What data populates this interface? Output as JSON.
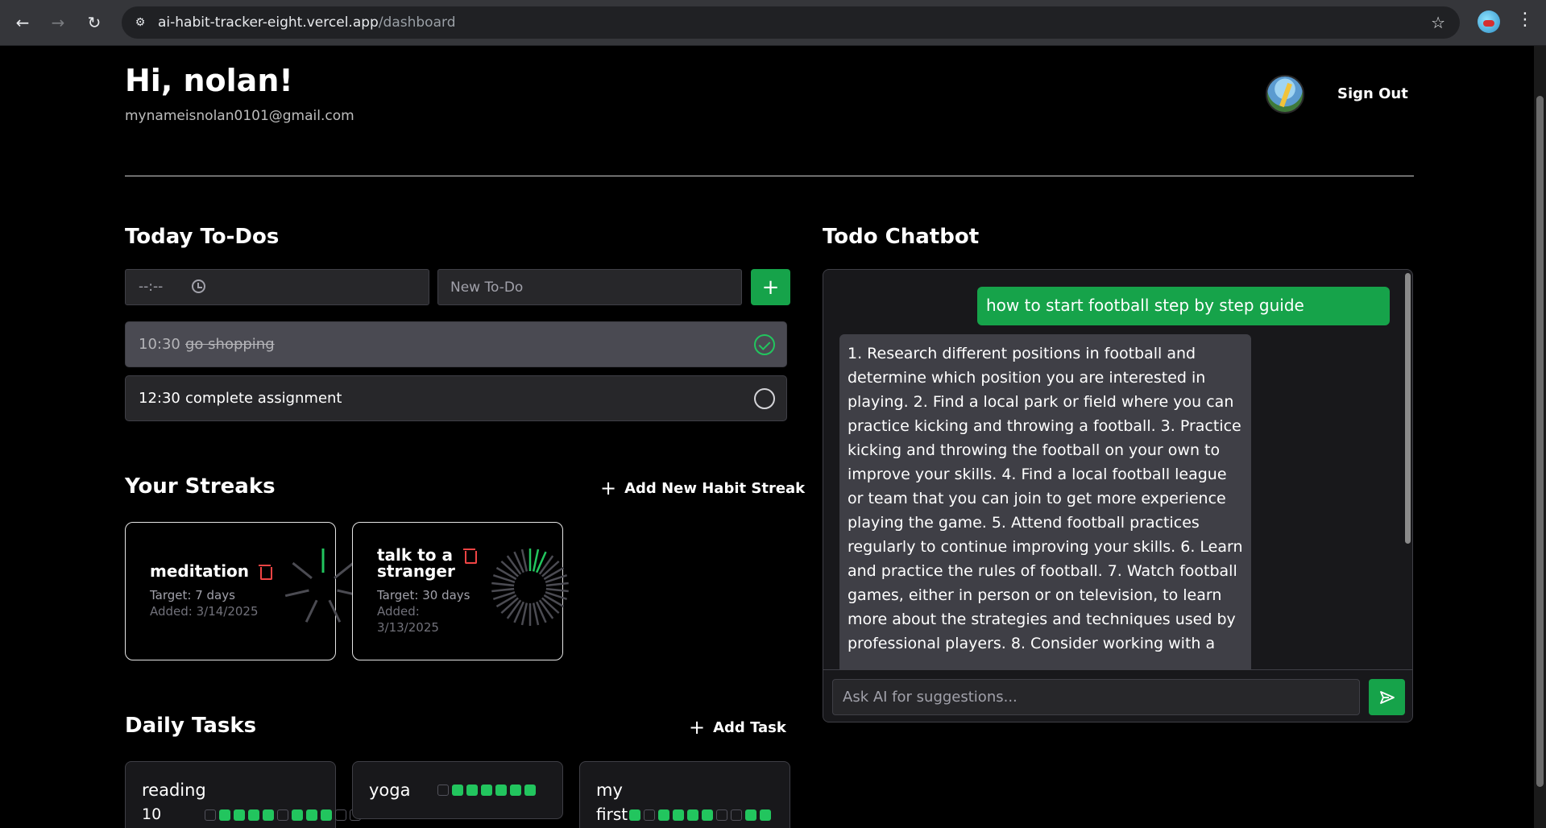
{
  "browser": {
    "url_host": "ai-habit-tracker-eight.vercel.app",
    "url_path": "/dashboard",
    "back_icon": "arrow-left-icon",
    "forward_icon": "arrow-right-icon",
    "reload_icon": "reload-icon"
  },
  "header": {
    "greeting": "Hi, nolan!",
    "email": "mynameisnolan0101@gmail.com",
    "sign_out": "Sign Out"
  },
  "todos": {
    "title": "Today To-Dos",
    "time_placeholder": "--:--",
    "todo_placeholder": "New To-Do",
    "add_label": "+",
    "items": [
      {
        "time": "10:30",
        "text": "go shopping",
        "done": true
      },
      {
        "time": "12:30",
        "text": "complete assignment",
        "done": false
      }
    ]
  },
  "streaks": {
    "title": "Your Streaks",
    "add_label": "Add New Habit Streak",
    "items": [
      {
        "name": "meditation",
        "target": "Target: 7 days",
        "added": "Added: 3/14/2025",
        "total_days": 7,
        "completed_days": 1
      },
      {
        "name": "talk to a stranger",
        "target": "Target: 30 days",
        "added": "Added: 3/13/2025",
        "total_days": 30,
        "completed_days": 3
      }
    ]
  },
  "daily_tasks": {
    "title": "Daily Tasks",
    "add_label": "Add Task",
    "items": [
      {
        "name": "reading",
        "sub": "10",
        "days": [
          0,
          1,
          1,
          1,
          1,
          0,
          1,
          1,
          1,
          0,
          0
        ]
      },
      {
        "name": "yoga",
        "sub": "",
        "days": [
          0,
          1,
          1,
          1,
          1,
          1,
          1
        ]
      },
      {
        "name": "my",
        "sub": "first",
        "days": [
          1,
          0,
          1,
          1,
          1,
          1,
          0,
          0,
          1,
          1
        ]
      }
    ]
  },
  "chatbot": {
    "title": "Todo Chatbot",
    "user_message": "how to start football step by step guide",
    "ai_message": "1. Research different positions in football and determine which position you are interested in playing. 2. Find a local park or field where you can practice kicking and throwing a football. 3. Practice kicking and throwing the football on your own to improve your skills. 4. Find a local football league or team that you can join to get more experience playing the game. 5. Attend football practices regularly to continue improving your skills. 6. Learn and practice the rules of football. 7. Watch football games, either in person or on television, to learn more about the strategies and techniques used by professional players. 8. Consider working with a",
    "input_placeholder": "Ask AI for suggestions...",
    "send_icon": "send-icon"
  },
  "colors": {
    "accent": "#16a34a",
    "success": "#22c55e",
    "danger": "#ef4444"
  }
}
